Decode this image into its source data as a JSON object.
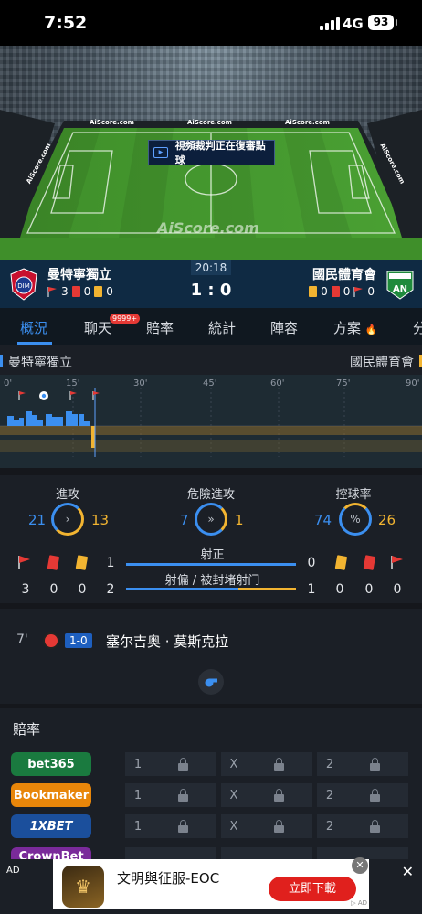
{
  "status": {
    "time": "7:52",
    "network": "4G",
    "battery": "93"
  },
  "pitch": {
    "board_texts": [
      "AiScore.com",
      "AiScore.com",
      "AiScore.com",
      "AiScore.com",
      "AiScore.com"
    ],
    "watermark": "AiScore.com",
    "var_notice": "視頻裁判正在復審點球"
  },
  "match": {
    "home": {
      "name": "曼特寧獨立",
      "corners": "3",
      "red": "0",
      "yellow": "0",
      "logo_text": "DIM"
    },
    "away": {
      "name": "國民體育會",
      "corners": "0",
      "red": "0",
      "yellow": "0",
      "logo_text": "AN"
    },
    "time": "20:18",
    "score": "1 : 0"
  },
  "tabs": [
    {
      "label": "概況",
      "active": true
    },
    {
      "label": "聊天",
      "badge": "9999+"
    },
    {
      "label": "賠率"
    },
    {
      "label": "統計"
    },
    {
      "label": "陣容"
    },
    {
      "label": "方案"
    },
    {
      "label": "分"
    }
  ],
  "timeline": {
    "home": "曼特寧獨立",
    "away": "國民體育會",
    "ticks": [
      "0'",
      "15'",
      "30'",
      "45'",
      "60'",
      "75'",
      "90'"
    ]
  },
  "stats": {
    "attack": {
      "title": "進攻",
      "home": "21",
      "away": "13"
    },
    "dangerous": {
      "title": "危險進攻",
      "home": "7",
      "away": "1"
    },
    "possession": {
      "title": "控球率",
      "home": "74",
      "away": "26",
      "symbol": "%"
    },
    "shots_on": {
      "title": "射正",
      "home": "1",
      "away": "0"
    },
    "shots_off": {
      "title": "射偏 / 被封堵射门",
      "home": "2",
      "away": "1"
    },
    "home_row": {
      "corners": "3",
      "red": "0",
      "yellow": "0"
    },
    "away_row": {
      "yellow": "0",
      "red": "0",
      "corners": "0"
    }
  },
  "event": {
    "minute": "7'",
    "score": "1-0",
    "player": "塞尔吉奥 · 莫斯克拉"
  },
  "odds": {
    "title": "賠率",
    "books": [
      {
        "name": "bet365",
        "color": "#1a7a3f"
      },
      {
        "name": "Bookmaker",
        "color": "#e8860a"
      },
      {
        "name": "1XBET",
        "color": "#1b4f9c"
      },
      {
        "name": "CrownBet",
        "color": "#7a2a9a"
      }
    ],
    "labels": [
      "1",
      "X",
      "2"
    ]
  },
  "ad": {
    "tag": "AD",
    "app_name": "文明與征服-EOC",
    "button": "立即下載",
    "footer": "AD"
  }
}
